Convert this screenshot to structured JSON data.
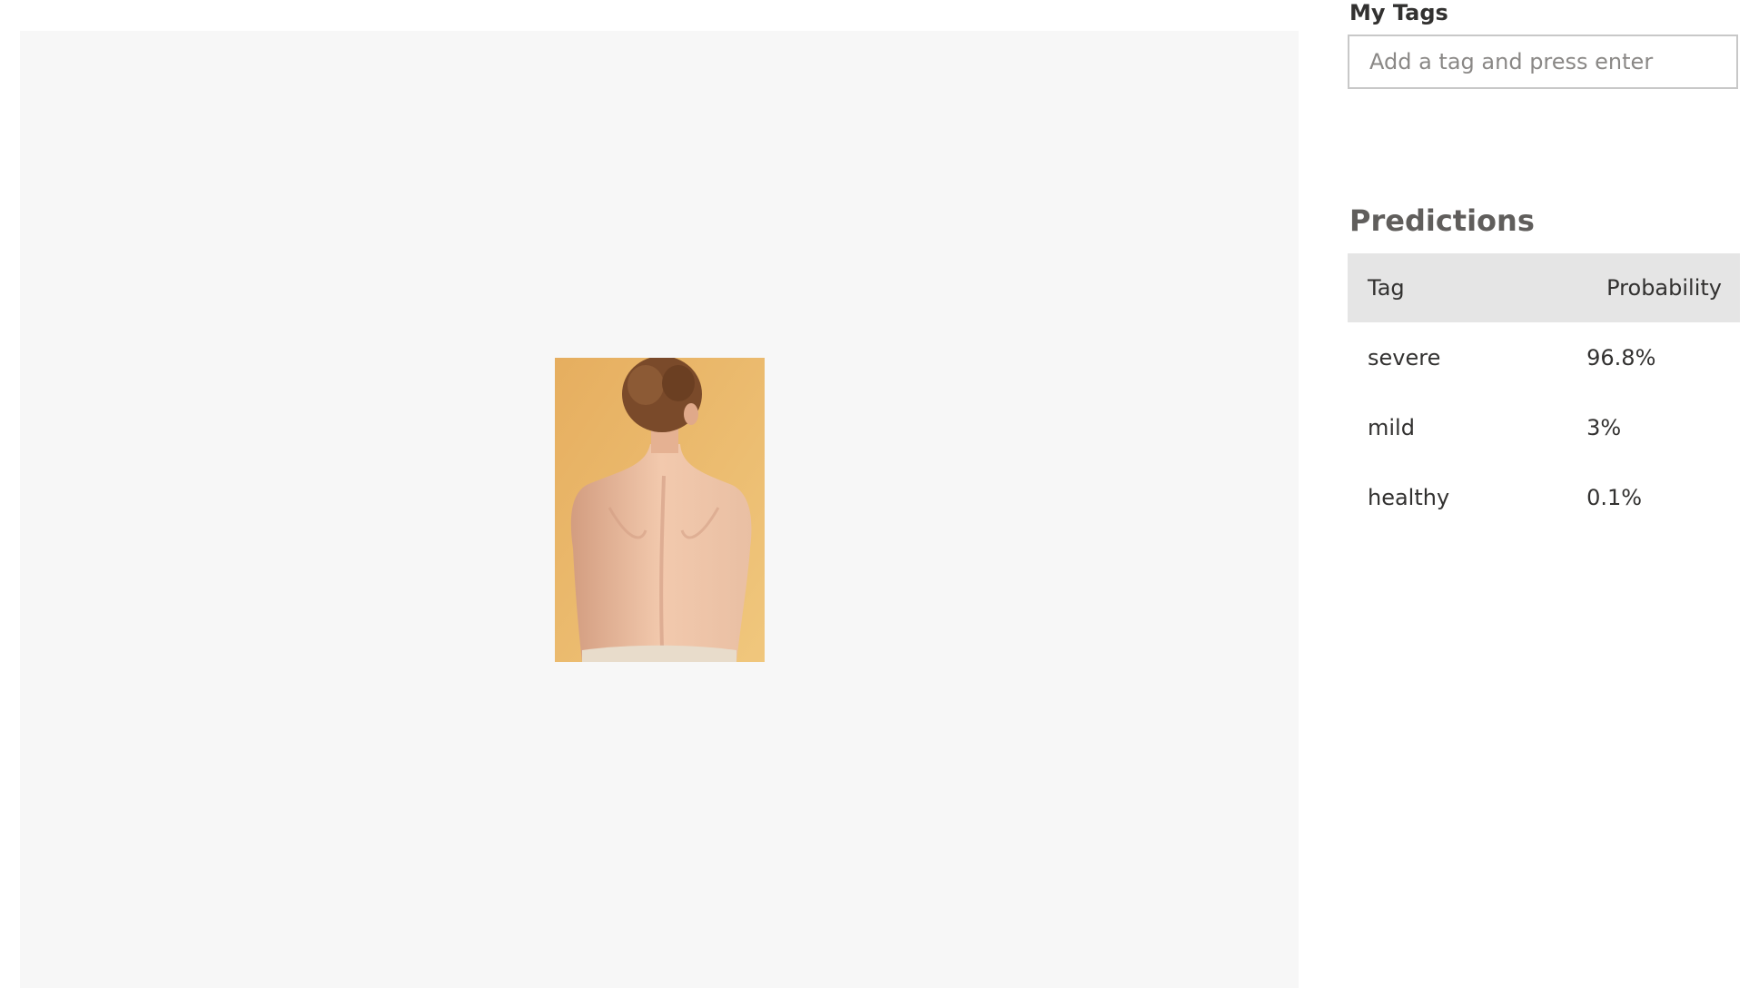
{
  "my_tags": {
    "title": "My Tags",
    "input_placeholder": "Add a tag and press enter",
    "input_value": ""
  },
  "predictions": {
    "title": "Predictions",
    "columns": {
      "tag": "Tag",
      "probability": "Probability"
    },
    "rows": [
      {
        "tag": "severe",
        "probability": "96.8%"
      },
      {
        "tag": "mild",
        "probability": "3%"
      },
      {
        "tag": "healthy",
        "probability": "0.1%"
      }
    ]
  },
  "viewer": {
    "image_subject": "photo of a person's bare back against a yellow background"
  },
  "colors": {
    "viewer_background": "#f7f7f7",
    "table_header_background": "#e5e5e5",
    "photo_background": "#e9b468",
    "skin_tone": "#e8b89b"
  }
}
